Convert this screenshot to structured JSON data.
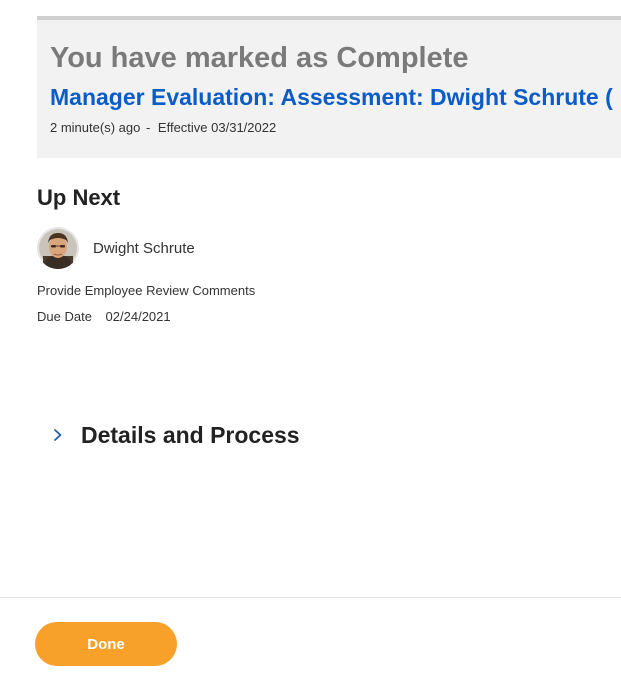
{
  "completion": {
    "heading": "You have marked as Complete",
    "link_text": "Manager Evaluation: Assessment: Dwight Schrute (",
    "time_ago": "2 minute(s) ago",
    "separator": "-",
    "effective": "Effective 03/31/2022"
  },
  "up_next": {
    "title": "Up Next",
    "person_name": "Dwight Schrute",
    "task_name": "Provide Employee Review Comments",
    "due_label": "Due Date",
    "due_value": "02/24/2021"
  },
  "details": {
    "label": "Details and Process",
    "icon": "chevron-right-icon"
  },
  "footer": {
    "done_label": "Done"
  },
  "colors": {
    "link": "#0b5cc7",
    "done_button": "#f7a12b",
    "panel_background": "#f2f2f2",
    "heading_gray": "#7a7a7a"
  }
}
